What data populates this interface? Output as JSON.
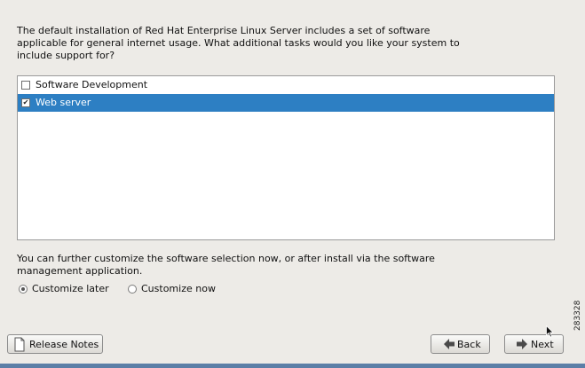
{
  "intro": {
    "line1": "The default installation of Red Hat Enterprise Linux Server includes a set of software",
    "line2": "applicable for general internet usage. What additional tasks would you like your system to",
    "line3": "include support for?"
  },
  "task_list": {
    "items": [
      {
        "label": "Software Development",
        "checked": false,
        "selected": false
      },
      {
        "label": "Web server",
        "checked": true,
        "selected": true
      }
    ]
  },
  "customize": {
    "line1": "You can further customize the software selection now, or after install via the software",
    "line2": "management application.",
    "later_label": "Customize later",
    "now_label": "Customize now",
    "selected": "later"
  },
  "buttons": {
    "release_notes": "Release Notes",
    "back": "Back",
    "next": "Next"
  },
  "figure_id": "283328",
  "colors": {
    "selection": "#2d7fc3",
    "background": "#edebe7",
    "footer": "#5c7fa7"
  }
}
